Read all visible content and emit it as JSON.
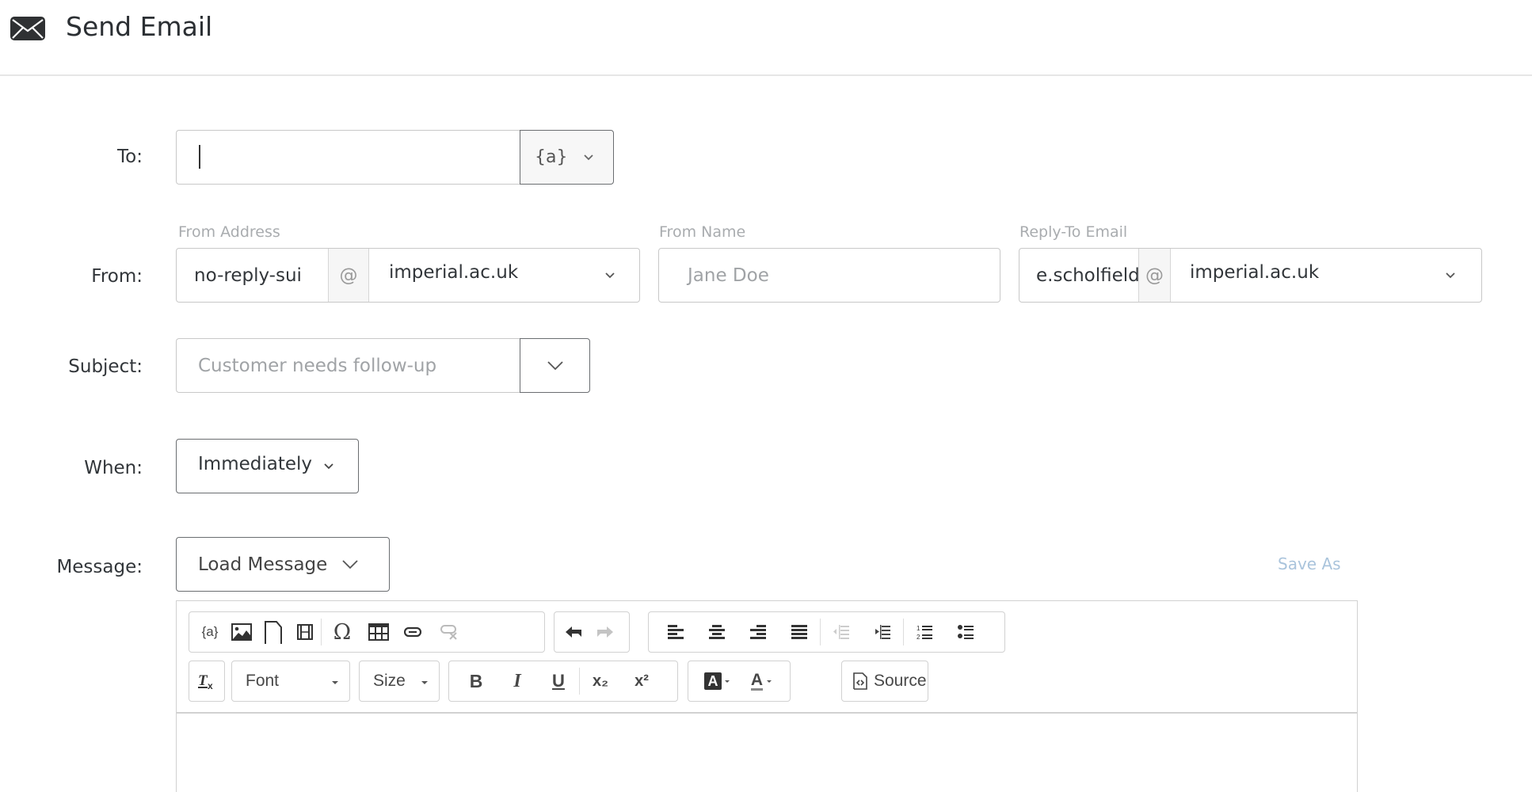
{
  "header": {
    "title": "Send Email",
    "icon": "envelope-icon"
  },
  "to": {
    "label": "To:",
    "value": "",
    "piped_text_button": "{a}"
  },
  "from": {
    "label": "From:",
    "from_address": {
      "caption": "From Address",
      "local_part": "no-reply-sui",
      "at": "@",
      "domain": "imperial.ac.uk"
    },
    "from_name": {
      "caption": "From Name",
      "placeholder": "Jane Doe",
      "value": ""
    },
    "reply_to": {
      "caption": "Reply-To Email",
      "local_part": "e.scholfield",
      "at": "@",
      "domain": "imperial.ac.uk"
    }
  },
  "subject": {
    "label": "Subject:",
    "placeholder": "Customer needs follow-up",
    "value": ""
  },
  "when": {
    "label": "When:",
    "selected": "Immediately"
  },
  "message": {
    "label": "Message:",
    "load_button": "Load Message",
    "save_as": "Save As",
    "toolbar": {
      "row1": {
        "insert": [
          {
            "name": "piped-text",
            "glyph": "{a}"
          },
          {
            "name": "image",
            "glyph": ""
          },
          {
            "name": "file",
            "glyph": ""
          },
          {
            "name": "video",
            "glyph": ""
          },
          {
            "name": "special-char",
            "glyph": "Ω"
          },
          {
            "name": "table",
            "glyph": ""
          },
          {
            "name": "link",
            "glyph": ""
          },
          {
            "name": "unlink",
            "glyph": ""
          }
        ],
        "history": [
          {
            "name": "undo"
          },
          {
            "name": "redo"
          }
        ],
        "align": [
          {
            "name": "align-left"
          },
          {
            "name": "align-center"
          },
          {
            "name": "align-right"
          },
          {
            "name": "justify"
          },
          {
            "name": "outdent"
          },
          {
            "name": "indent"
          },
          {
            "name": "numbered-list"
          },
          {
            "name": "bulleted-list"
          }
        ]
      },
      "row2": {
        "remove_format": "Tx",
        "font_label": "Font",
        "size_label": "Size",
        "bold": "B",
        "italic": "I",
        "underline": "U",
        "subscript": "x₂",
        "superscript": "x²",
        "bg_color": "A",
        "text_color": "A",
        "source_label": "Source"
      }
    },
    "body": ""
  }
}
